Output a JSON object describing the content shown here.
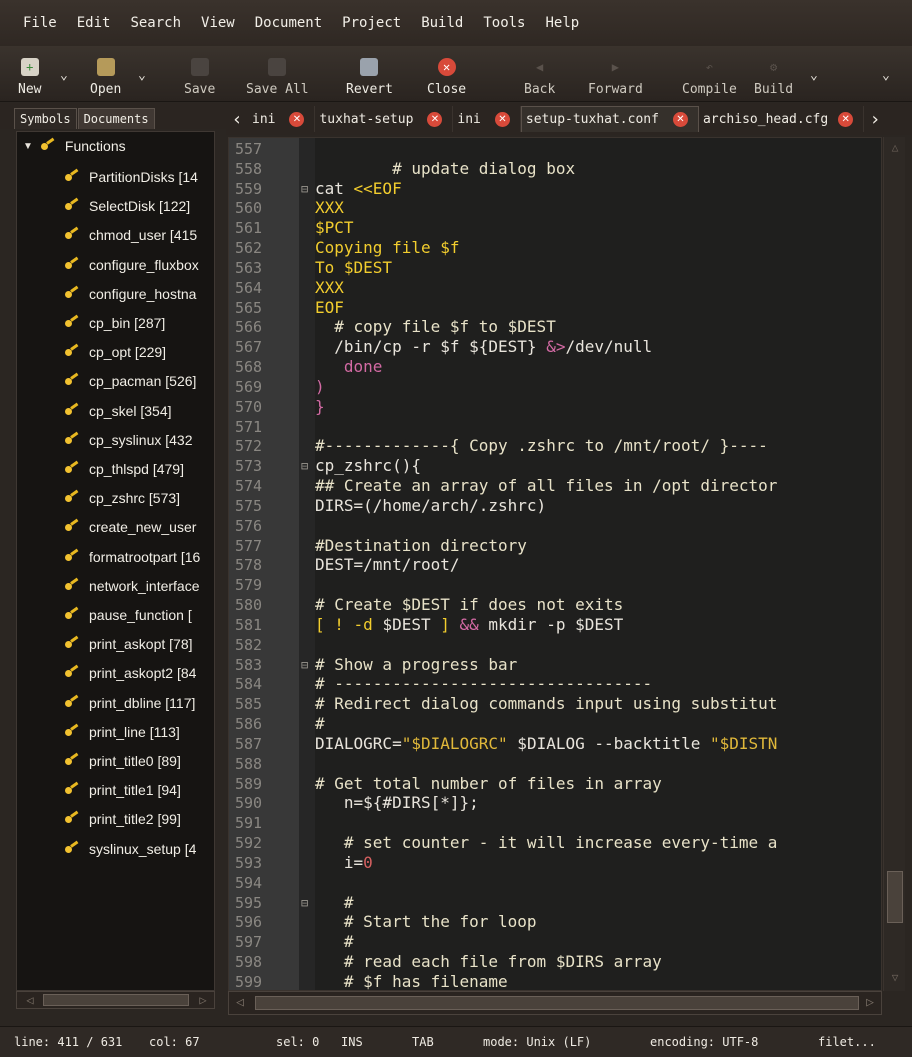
{
  "menu": [
    "File",
    "Edit",
    "Search",
    "View",
    "Document",
    "Project",
    "Build",
    "Tools",
    "Help"
  ],
  "toolbar": {
    "new": "New",
    "open": "Open",
    "save": "Save",
    "save_all": "Save All",
    "revert": "Revert",
    "close": "Close",
    "back": "Back",
    "forward": "Forward",
    "compile": "Compile",
    "build": "Build"
  },
  "sidebar": {
    "tabs": [
      "Symbols",
      "Documents"
    ],
    "root": "Functions",
    "items": [
      "PartitionDisks [14",
      "SelectDisk [122]",
      "chmod_user [415",
      "configure_fluxbox",
      "configure_hostna",
      "cp_bin [287]",
      "cp_opt [229]",
      "cp_pacman [526]",
      "cp_skel [354]",
      "cp_syslinux [432",
      "cp_thlspd [479]",
      "cp_zshrc [573]",
      "create_new_user",
      "formatrootpart [16",
      "network_interface",
      "pause_function [",
      "print_askopt [78]",
      "print_askopt2 [84",
      "print_dbline [117]",
      "print_line [113]",
      "print_title0 [89]",
      "print_title1 [94]",
      "print_title2 [99]",
      "syslinux_setup [4"
    ]
  },
  "tabs": [
    "ini",
    "tuxhat-setup",
    "ini",
    "setup-tuxhat.conf",
    "archiso_head.cfg"
  ],
  "editor": {
    "lines": [
      {
        "n": "557",
        "f": "",
        "segs": [
          [
            "",
            ""
          ]
        ]
      },
      {
        "n": "558",
        "f": "",
        "segs": [
          [
            "cmt",
            "        # update dialog box"
          ]
        ]
      },
      {
        "n": "559",
        "f": "⊟",
        "segs": [
          [
            "",
            "cat "
          ],
          [
            "kw",
            "<<EOF"
          ]
        ]
      },
      {
        "n": "560",
        "f": "",
        "segs": [
          [
            "kw",
            "XXX"
          ]
        ]
      },
      {
        "n": "561",
        "f": "",
        "segs": [
          [
            "kw",
            "$PCT"
          ]
        ]
      },
      {
        "n": "562",
        "f": "",
        "segs": [
          [
            "kw",
            "Copying file $f"
          ]
        ]
      },
      {
        "n": "563",
        "f": "",
        "segs": [
          [
            "kw",
            "To $DEST"
          ]
        ]
      },
      {
        "n": "564",
        "f": "",
        "segs": [
          [
            "kw",
            "XXX"
          ]
        ]
      },
      {
        "n": "565",
        "f": "",
        "segs": [
          [
            "kw",
            "EOF"
          ]
        ]
      },
      {
        "n": "566",
        "f": "",
        "segs": [
          [
            "cmt",
            "  # copy file $f to $DEST"
          ]
        ]
      },
      {
        "n": "567",
        "f": "",
        "segs": [
          [
            "",
            "  /bin/cp -r $f ${DEST} "
          ],
          [
            "op",
            "&>"
          ],
          [
            "",
            "/dev/null"
          ]
        ]
      },
      {
        "n": "568",
        "f": "",
        "segs": [
          [
            "op",
            "   done"
          ]
        ]
      },
      {
        "n": "569",
        "f": "",
        "segs": [
          [
            "op",
            ")"
          ]
        ]
      },
      {
        "n": "570",
        "f": "",
        "segs": [
          [
            "op",
            "}"
          ]
        ]
      },
      {
        "n": "571",
        "f": "",
        "segs": [
          [
            "",
            ""
          ]
        ]
      },
      {
        "n": "572",
        "f": "",
        "segs": [
          [
            "cmt",
            "#-------------{ Copy .zshrc to /mnt/root/ }----"
          ]
        ]
      },
      {
        "n": "573",
        "f": "⊟",
        "segs": [
          [
            "",
            "cp_zshrc(){"
          ]
        ]
      },
      {
        "n": "574",
        "f": "",
        "segs": [
          [
            "cmt",
            "## Create an array of all files in /opt director"
          ]
        ]
      },
      {
        "n": "575",
        "f": "",
        "segs": [
          [
            "",
            "DIRS=(/home/arch/.zshrc)"
          ]
        ]
      },
      {
        "n": "576",
        "f": "",
        "segs": [
          [
            "",
            ""
          ]
        ]
      },
      {
        "n": "577",
        "f": "",
        "segs": [
          [
            "cmt",
            "#Destination directory"
          ]
        ]
      },
      {
        "n": "578",
        "f": "",
        "segs": [
          [
            "",
            "DEST=/mnt/root/"
          ]
        ]
      },
      {
        "n": "579",
        "f": "",
        "segs": [
          [
            "",
            ""
          ]
        ]
      },
      {
        "n": "580",
        "f": "",
        "segs": [
          [
            "cmt",
            "# Create $DEST if does not exits"
          ]
        ]
      },
      {
        "n": "581",
        "f": "",
        "segs": [
          [
            "kw",
            "[ ! -d "
          ],
          [
            "",
            "$DEST "
          ],
          [
            "kw",
            "] "
          ],
          [
            "op",
            "&&"
          ],
          [
            "",
            " mkdir -p $DEST"
          ]
        ]
      },
      {
        "n": "582",
        "f": "",
        "segs": [
          [
            "",
            ""
          ]
        ]
      },
      {
        "n": "583",
        "f": "⊟",
        "segs": [
          [
            "cmt",
            "# Show a progress bar"
          ]
        ]
      },
      {
        "n": "584",
        "f": "",
        "segs": [
          [
            "cmt",
            "# ---------------------------------"
          ]
        ]
      },
      {
        "n": "585",
        "f": "",
        "segs": [
          [
            "cmt",
            "# Redirect dialog commands input using substitut"
          ]
        ]
      },
      {
        "n": "586",
        "f": "",
        "segs": [
          [
            "cmt",
            "#"
          ]
        ]
      },
      {
        "n": "587",
        "f": "",
        "segs": [
          [
            "",
            "DIALOGRC="
          ],
          [
            "str",
            "\"$DIALOGRC\""
          ],
          [
            "",
            " $DIALOG --backtitle "
          ],
          [
            "str",
            "\"$DISTN"
          ]
        ]
      },
      {
        "n": "588",
        "f": "",
        "segs": [
          [
            "",
            ""
          ]
        ]
      },
      {
        "n": "589",
        "f": "",
        "segs": [
          [
            "cmt",
            "# Get total number of files in array"
          ]
        ]
      },
      {
        "n": "590",
        "f": "",
        "segs": [
          [
            "",
            "   n=${#DIRS[*]};"
          ]
        ]
      },
      {
        "n": "591",
        "f": "",
        "segs": [
          [
            "",
            ""
          ]
        ]
      },
      {
        "n": "592",
        "f": "",
        "segs": [
          [
            "cmt",
            "   # set counter - it will increase every-time a"
          ]
        ]
      },
      {
        "n": "593",
        "f": "",
        "segs": [
          [
            "",
            "   i="
          ],
          [
            "num-c",
            "0"
          ]
        ]
      },
      {
        "n": "594",
        "f": "",
        "segs": [
          [
            "",
            ""
          ]
        ]
      },
      {
        "n": "595",
        "f": "⊟",
        "segs": [
          [
            "cmt",
            "   #"
          ]
        ]
      },
      {
        "n": "596",
        "f": "",
        "segs": [
          [
            "cmt",
            "   # Start the for loop"
          ]
        ]
      },
      {
        "n": "597",
        "f": "",
        "segs": [
          [
            "cmt",
            "   #"
          ]
        ]
      },
      {
        "n": "598",
        "f": "",
        "segs": [
          [
            "cmt",
            "   # read each file from $DIRS array"
          ]
        ]
      },
      {
        "n": "599",
        "f": "",
        "segs": [
          [
            "cmt",
            "   # $f has filename"
          ]
        ]
      }
    ]
  },
  "status": {
    "line": "line: 411 / 631",
    "col": "col: 67",
    "sel": "sel: 0",
    "ins": "INS",
    "tab": "TAB",
    "mode": "mode: Unix (LF)",
    "encoding": "encoding: UTF-8",
    "filetype": "filet..."
  }
}
